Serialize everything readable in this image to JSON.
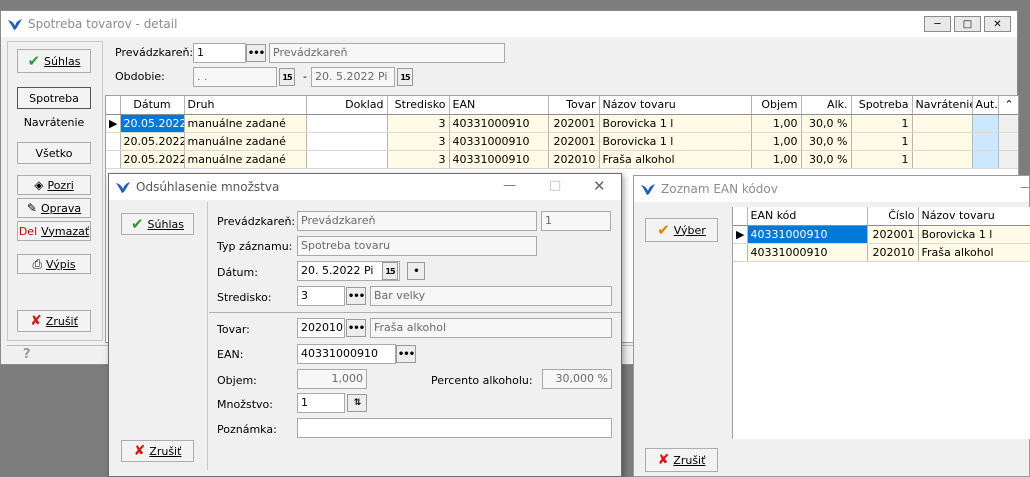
{
  "main": {
    "title": "Spotreba tovarov - detail",
    "ok_label": "Súhlas",
    "prevadzkaren_label": "Prevádzkareň:",
    "prevadzkaren_code": "1",
    "prevadzkaren_name": "Prevádzkareň",
    "obdobie_label": "Obdobie:",
    "obdobie_from": " .  .",
    "obdobie_to": "20. 5.2022  Pi",
    "side_buttons": {
      "spotreba": "Spotreba",
      "navratenie": "Navrátenie",
      "vsetko": "Všetko",
      "pozri": "Pozri",
      "oprava": "Oprava",
      "del": "Del",
      "vymazat": "Vymazať",
      "vypis": "Výpis",
      "zrusit": "Zrušiť"
    },
    "table": {
      "headers": [
        "Dátum",
        "Druh",
        "Doklad",
        "Stredisko",
        "EAN",
        "Tovar",
        "Názov tovaru",
        "Objem",
        "Alk.",
        "Spotreba",
        "Navrátenie",
        "Aut."
      ],
      "rows": [
        [
          "20.05.2022",
          "manuálne zadané",
          "",
          "3",
          "40331000910",
          "202001",
          "Borovicka 1 l",
          "1,00",
          "30,0 %",
          "1",
          "",
          ""
        ],
        [
          "20.05.2022",
          "manuálne zadané",
          "",
          "3",
          "40331000910",
          "202001",
          "Borovicka 1 l",
          "1,00",
          "30,0 %",
          "1",
          "",
          ""
        ],
        [
          "20.05.2022",
          "manuálne zadané",
          "",
          "3",
          "40331000910",
          "202010",
          "Fraša alkohol",
          "1,00",
          "30,0 %",
          "1",
          "",
          ""
        ]
      ]
    }
  },
  "dialog": {
    "title": "Odsúhlasenie množstva",
    "ok_label": "Súhlas",
    "cancel_label": "Zrušiť",
    "prevadzkaren_label": "Prevádzkareň:",
    "prevadzkaren_name": "Prevádzkareň",
    "prevadzkaren_code": "1",
    "typ_label": "Typ záznamu:",
    "typ_value": "Spotreba tovaru",
    "datum_label": "Dátum:",
    "datum_value": "20. 5.2022  Pi",
    "stredisko_label": "Stredisko:",
    "stredisko_code": "3",
    "stredisko_name": "Bar velky",
    "tovar_label": "Tovar:",
    "tovar_code": "202010",
    "tovar_name": "Fraša alkohol",
    "ean_label": "EAN:",
    "ean_value": "40331000910",
    "objem_label": "Objem:",
    "objem_value": "1,000",
    "percento_label": "Percento alkoholu:",
    "percento_value": "30,000 %",
    "mnozstvo_label": "Množstvo:",
    "mnozstvo_value": "1",
    "poznamka_label": "Poznámka:",
    "poznamka_value": ""
  },
  "ean_window": {
    "title": "Zoznam EAN kódov",
    "select_label": "Výber",
    "cancel_label": "Zrušiť",
    "headers": [
      "EAN kód",
      "Číslo",
      "Názov tovaru"
    ],
    "rows": [
      [
        "40331000910",
        "202001",
        "Borovicka 1 l"
      ],
      [
        "40331000910",
        "202010",
        "Fraša alkohol"
      ]
    ]
  },
  "colors": {
    "selected_row": "#0078d7",
    "row_yellow": "#fffbe6",
    "aut_cell": "#cce8ff"
  }
}
